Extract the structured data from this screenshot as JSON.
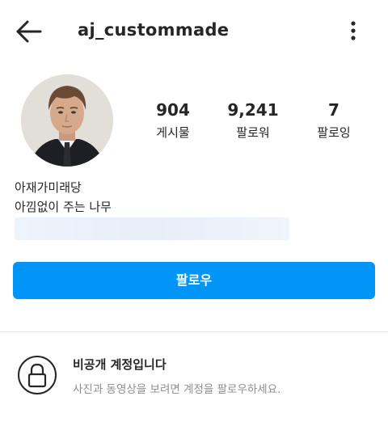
{
  "header": {
    "username": "aj_custommade",
    "back_icon": "arrow-left-icon",
    "more_icon": "more-vertical-icon"
  },
  "profile": {
    "avatar": "profile-photo",
    "stats": [
      {
        "value": "904",
        "label": "게시물"
      },
      {
        "value": "9,241",
        "label": "팔로워"
      },
      {
        "value": "7",
        "label": "팔로잉"
      }
    ],
    "bio_lines": [
      "아재가미래당",
      "아낌없이 주는 나무"
    ]
  },
  "actions": {
    "follow_label": "팔로우",
    "follow_color": "#0095f6"
  },
  "private": {
    "title": "비공개 계정입니다",
    "description": "사진과 동영상을 보려면 계정을 팔로우하세요.",
    "icon": "lock-icon"
  }
}
